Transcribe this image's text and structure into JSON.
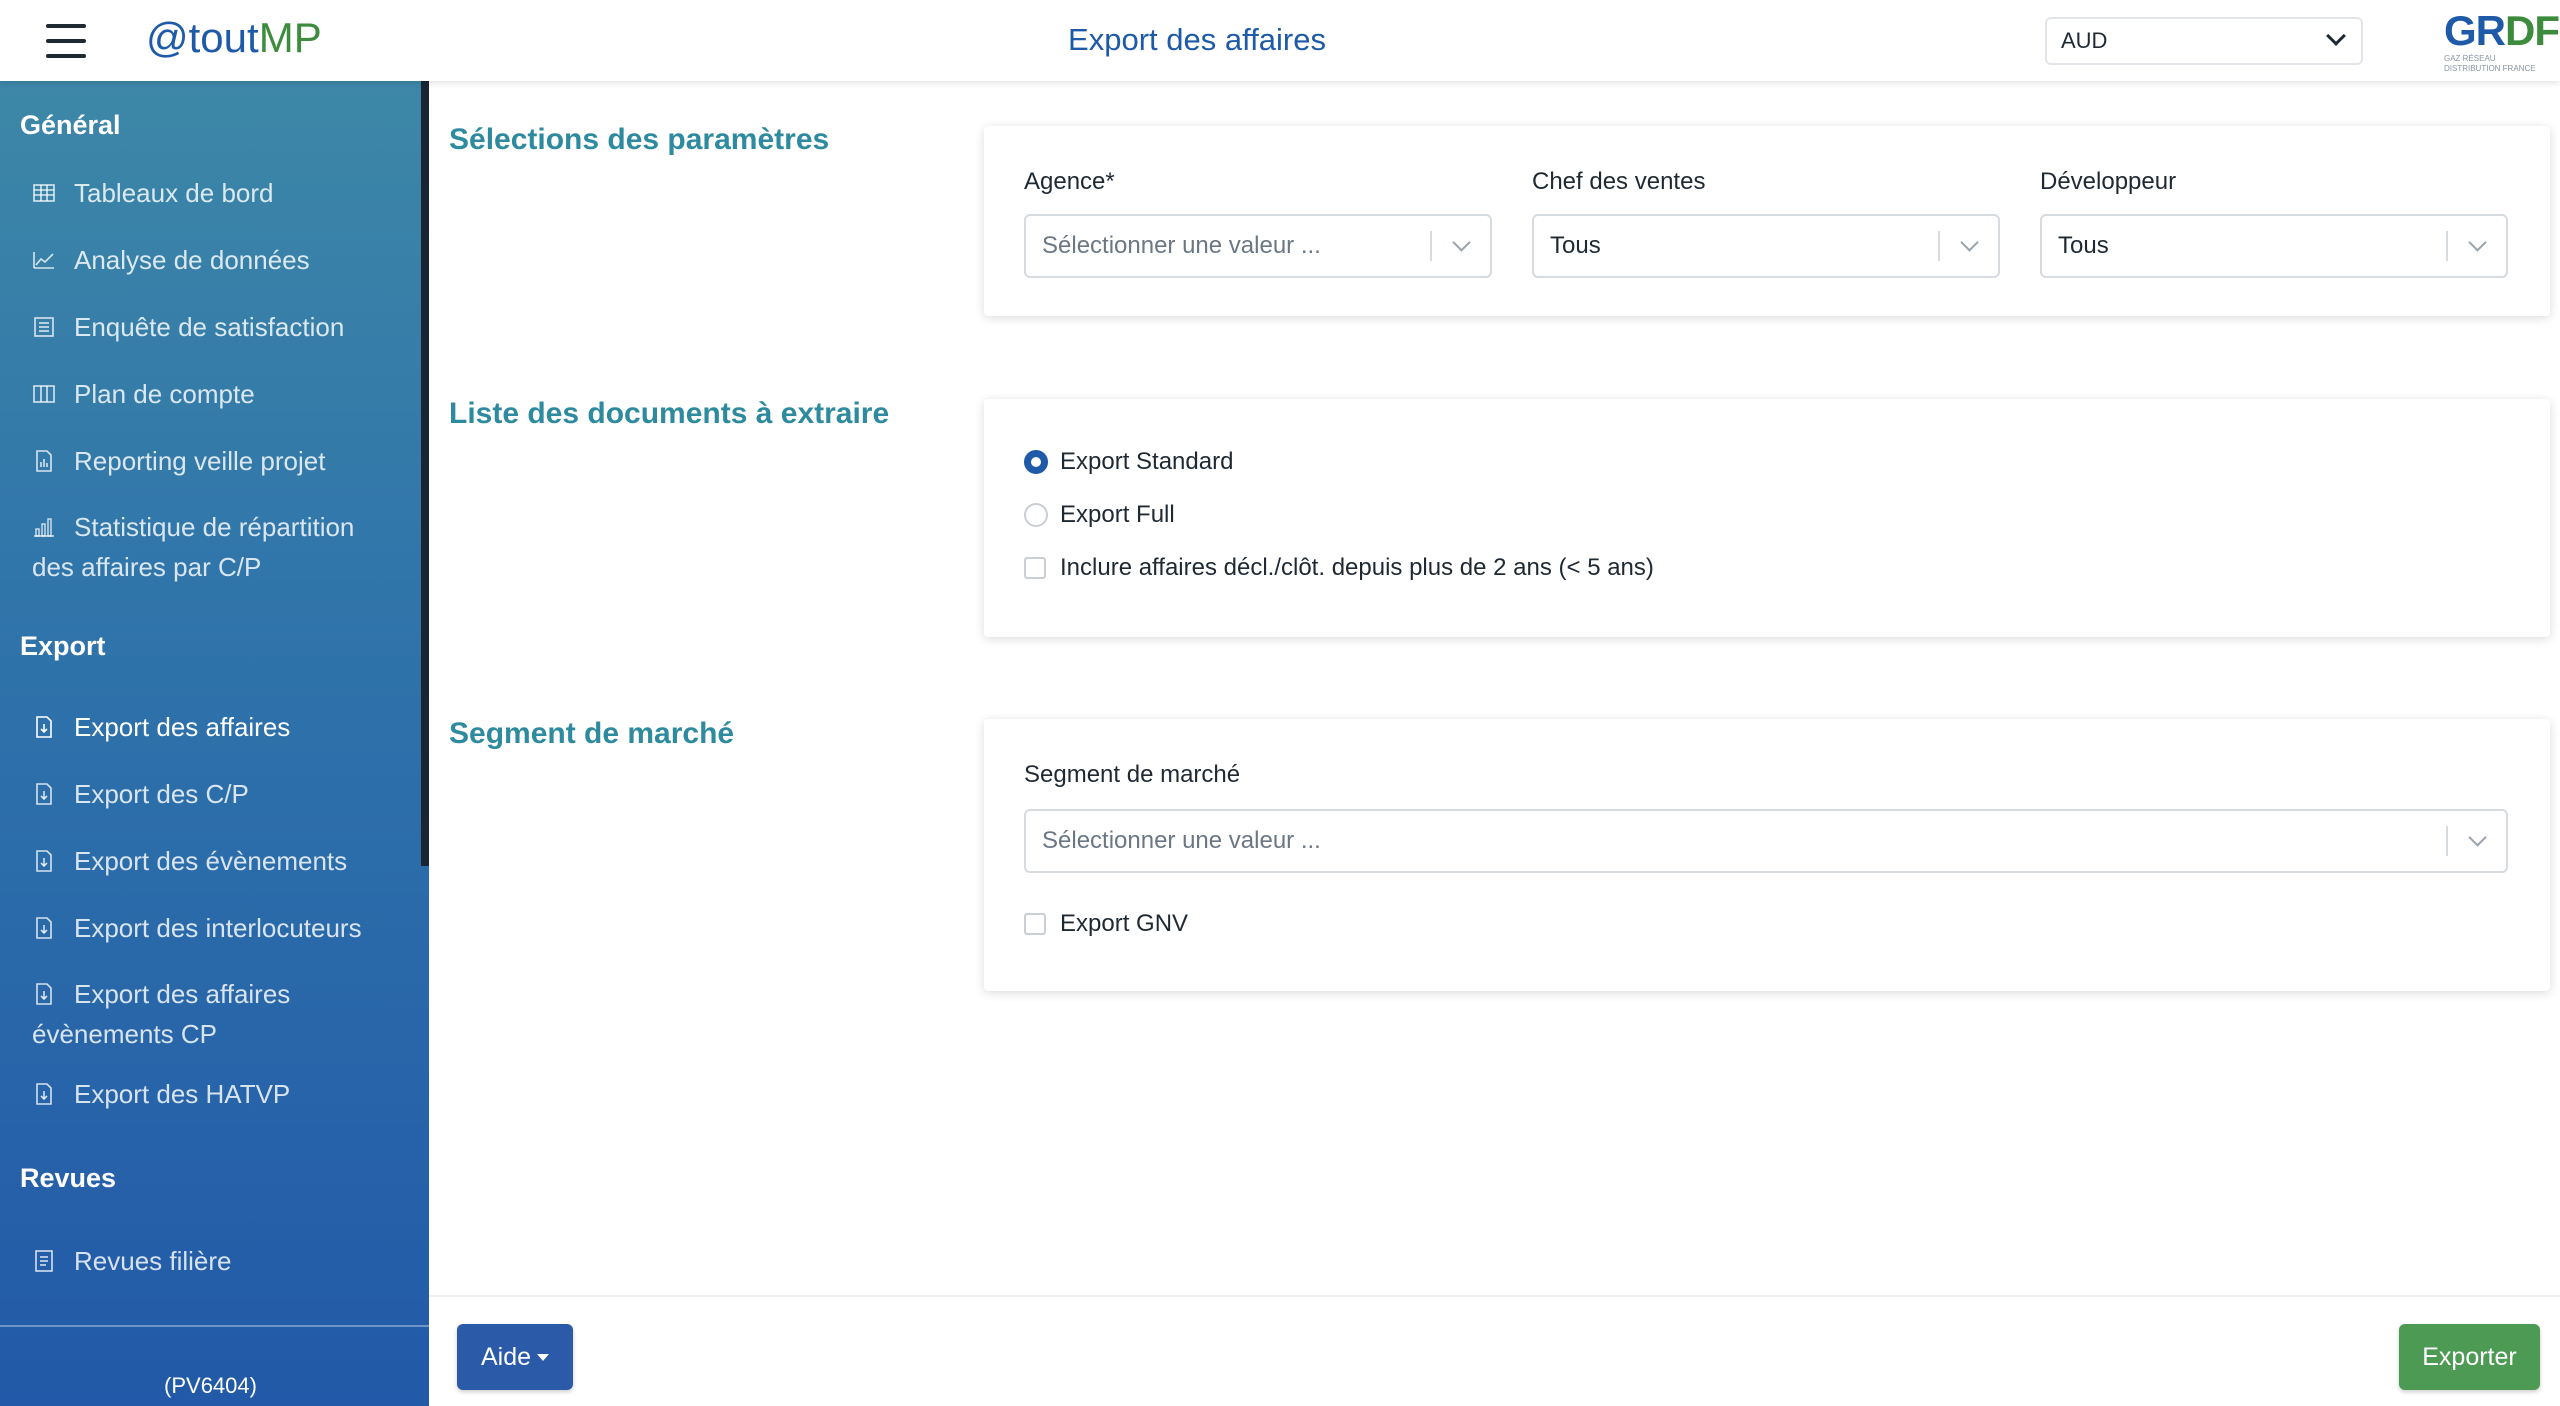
{
  "header": {
    "brand_prefix": "@tout",
    "brand_suffix": "MP",
    "title": "Export des affaires",
    "agency_selected": "AUD",
    "logo_text_main": "GR",
    "logo_text_accent": "DF",
    "logo_tagline": "GAZ RÉSEAU DISTRIBUTION FRANCE"
  },
  "sidebar": {
    "sections": [
      {
        "title": "Général",
        "items": [
          {
            "label": "Tableaux de bord",
            "icon": "table-icon"
          },
          {
            "label": "Analyse de données",
            "icon": "line-chart-icon"
          },
          {
            "label": "Enquête de satisfaction",
            "icon": "survey-icon"
          },
          {
            "label": "Plan de compte",
            "icon": "columns-icon"
          },
          {
            "label": "Reporting veille projet",
            "icon": "report-icon"
          },
          {
            "label": "Statistique de répartition des affaires par C/P",
            "icon": "bar-chart-icon"
          }
        ]
      },
      {
        "title": "Export",
        "items": [
          {
            "label": "Export des affaires",
            "icon": "file-export-icon"
          },
          {
            "label": "Export des C/P",
            "icon": "file-export-icon"
          },
          {
            "label": "Export des évènements",
            "icon": "file-export-icon"
          },
          {
            "label": "Export des interlocuteurs",
            "icon": "file-export-icon"
          },
          {
            "label": "Export des affaires évènements CP",
            "icon": "file-export-icon"
          },
          {
            "label": "Export des HATVP",
            "icon": "file-export-icon"
          }
        ]
      },
      {
        "title": "Revues",
        "items": [
          {
            "label": "Revues filière",
            "icon": "document-icon"
          }
        ]
      }
    ],
    "version": "(PV6404)"
  },
  "main": {
    "params": {
      "heading": "Sélections des paramètres",
      "agence_label": "Agence*",
      "agence_placeholder": "Sélectionner une valeur ...",
      "chef_label": "Chef des ventes",
      "chef_value": "Tous",
      "dev_label": "Développeur",
      "dev_value": "Tous"
    },
    "documents": {
      "heading": "Liste des documents à extraire",
      "option_standard": "Export Standard",
      "option_full": "Export Full",
      "include_label": "Inclure affaires décl./clôt. depuis plus de 2 ans (< 5 ans)",
      "selected": "Export Standard"
    },
    "segment": {
      "heading": "Segment de marché",
      "label": "Segment de marché",
      "placeholder": "Sélectionner une valeur ...",
      "gnv_label": "Export GNV"
    }
  },
  "footer": {
    "help_label": "Aide",
    "export_label": "Exporter"
  }
}
